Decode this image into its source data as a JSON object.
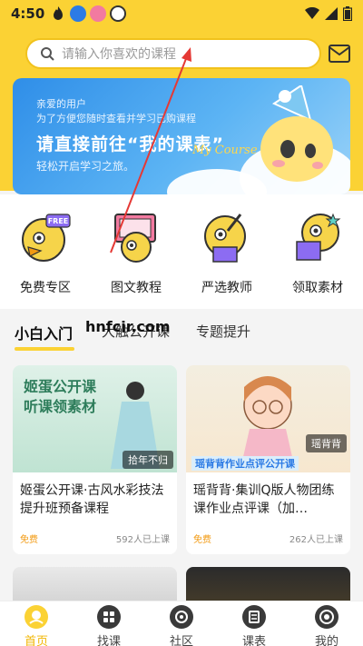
{
  "status_bar": {
    "time": "4:50",
    "icons": [
      "fire-icon",
      "app-icon-blue",
      "app-icon-pink",
      "app-icon-white"
    ],
    "right_icons": [
      "wifi-icon",
      "signal-icon",
      "battery-icon"
    ]
  },
  "search": {
    "placeholder": "请输入你喜欢的课程"
  },
  "banner": {
    "line1": "亲爱的用户",
    "line2": "为了方便您随时查看并学习已购课程",
    "headline": "请直接前往“我的课表”",
    "line3": "轻松开启学习之旅。",
    "signature": "My Course"
  },
  "categories": [
    {
      "label": "免费专区",
      "badge": "FREE"
    },
    {
      "label": "图文教程"
    },
    {
      "label": "严选教师"
    },
    {
      "label": "领取素材"
    }
  ],
  "tabs": [
    {
      "label": "小白入门",
      "active": true
    },
    {
      "label": "大触公开课",
      "active": false
    },
    {
      "label": "专题提升",
      "active": false
    }
  ],
  "watermark": "hnfcir.com",
  "courses": [
    {
      "title": "姬蛋公开课·古风水彩技法提升班预备课程",
      "thumb_title_1": "姬蛋公开课",
      "thumb_title_2": "听课领素材",
      "thumb_tag": "拾年不归",
      "price": "免费",
      "enrolled": "592人已上课"
    },
    {
      "title": "瑶背背·集训Q版人物团练课作业点评课（加…",
      "thumb_title_1": "瑶背背作业点评公开课",
      "thumb_tag": "瑶背背",
      "price": "免费",
      "enrolled": "262人已上课"
    }
  ],
  "bottom_nav": [
    {
      "label": "首页",
      "active": true,
      "icon": "home-icon"
    },
    {
      "label": "找课",
      "active": false,
      "icon": "grid-icon"
    },
    {
      "label": "社区",
      "active": false,
      "icon": "community-icon"
    },
    {
      "label": "课表",
      "active": false,
      "icon": "schedule-icon"
    },
    {
      "label": "我的",
      "active": false,
      "icon": "profile-icon"
    }
  ],
  "colors": {
    "brand_yellow": "#fbd234",
    "free_orange": "#f29a12",
    "annotation_red": "#e53935"
  }
}
